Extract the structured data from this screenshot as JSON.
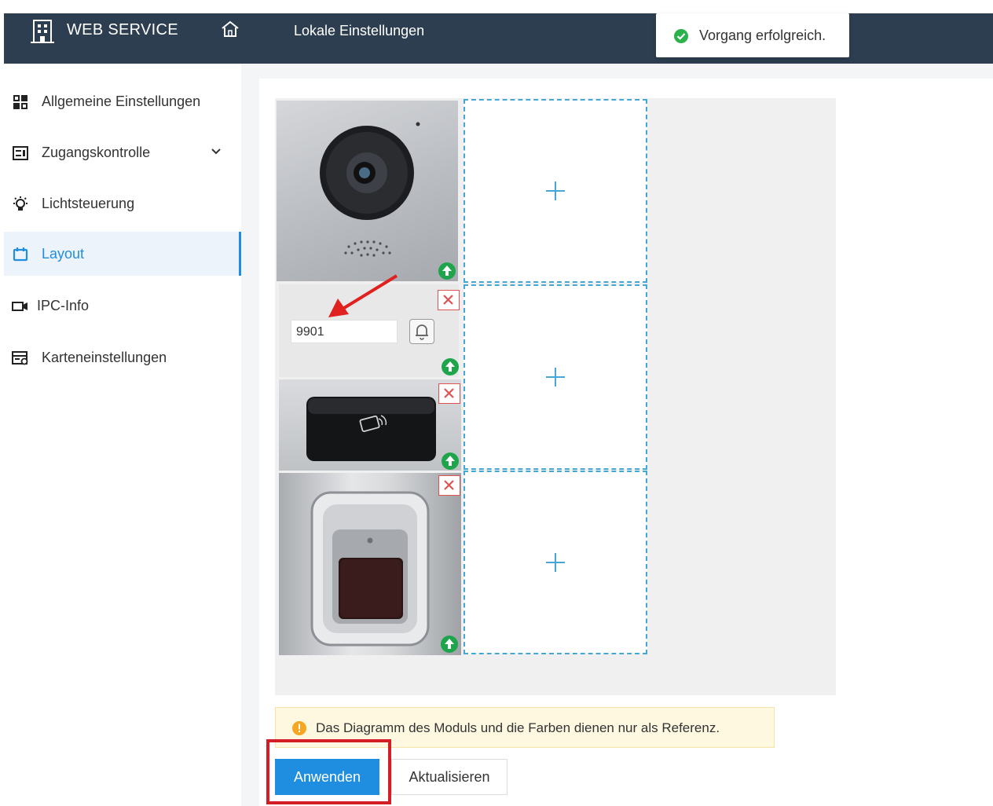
{
  "header": {
    "brand": "WEB SERVICE",
    "title": "Lokale Einstellungen",
    "brand_icon": "building-icon",
    "home_icon": "home-icon",
    "background_color": "#2c3e50"
  },
  "toast": {
    "message": "Vorgang erfolgreich.",
    "icon": "success-check-icon",
    "icon_color": "#2bb24c"
  },
  "sidebar": {
    "items": [
      {
        "label": "Allgemeine Einstellungen",
        "icon": "grid-icon"
      },
      {
        "label": "Zugangskontrolle",
        "icon": "access-control-icon",
        "expandable": true
      },
      {
        "label": "Lichtsteuerung",
        "icon": "light-bulb-icon"
      },
      {
        "label": "Layout",
        "icon": "layout-icon",
        "active": true
      },
      {
        "label": "IPC-Info",
        "icon": "camera-icon"
      },
      {
        "label": "Karteneinstellungen",
        "icon": "card-settings-icon"
      }
    ],
    "active_color": "#1f8de0"
  },
  "layout": {
    "keypad_number": "9901",
    "modules": [
      "camera-module",
      "keypad-module",
      "card-reader-module",
      "fingerprint-module"
    ],
    "empty_slots": 3
  },
  "note": {
    "text": "Das Diagramm des Moduls und die Farben dienen nur als Referenz.",
    "icon": "info-icon",
    "icon_color": "#f5a623"
  },
  "buttons": {
    "apply": "Anwenden",
    "refresh": "Aktualisieren",
    "apply_color": "#1f8de0",
    "highlight_color": "#d31e25"
  }
}
